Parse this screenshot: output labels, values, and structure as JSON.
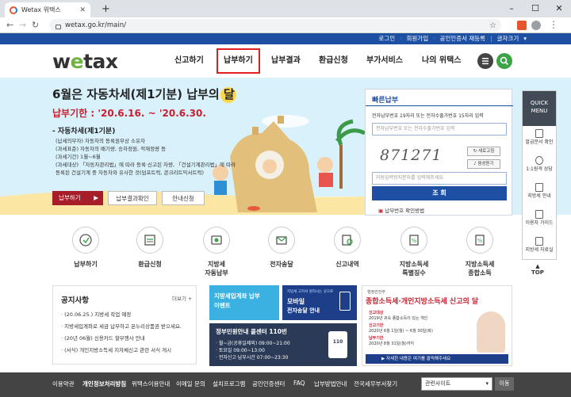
{
  "browser": {
    "tab_title": "Wetax 위택스",
    "url": "wetax.go.kr/main/"
  },
  "util_links": [
    "로그인",
    "회원가입",
    "공인인증서 재등록",
    "글자크기"
  ],
  "header": {
    "logo_pre": "w",
    "logo_mid": "e",
    "logo_post": "tax",
    "menu": [
      "신고하기",
      "납부하기",
      "납부결과",
      "환급신청",
      "부가서비스",
      "나의 위택스"
    ]
  },
  "hero": {
    "title": "6월은 자동차세(제1기분) 납부의 달",
    "period_label": "납부기한",
    "period_value": " : '20.6.16. ~ '20.6.30.",
    "section_title": "- 자동차세(제1기분)",
    "lines": [
      "(납세의무자) 자동차의 등록원부상 소유자",
      "(과세표준) 자동차의 배기량, 승차정원, 적재정량 등",
      "(과세기간) 1월~6월",
      "(과세대상) 「자동차관리법」에 따라 등록·신고된 차량, 「건설기계관리법」에 따라",
      "등록된 건설기계 중 자동차와 유사한 것(덤프트럭, 콘크리트믹서트럭)"
    ],
    "btn_pay": "납부하기",
    "btn_check": "납부결과확인",
    "btn_guide": "안내신청"
  },
  "quick_pay": {
    "title": "빠른납부",
    "desc": "전자납부번호 19자리 또는 전자수출가번호 15자리 입력",
    "input_placeholder": "전자납부번호 또는 전자수출가번호 입력",
    "captcha": "871271",
    "refresh": "새로고침",
    "audio": "음성듣기",
    "captcha_placeholder": "자동입력방지문자를 입력해주세요.",
    "submit": "조 회",
    "link": "납부번호 확인방법"
  },
  "quick_menu": {
    "head_1": "QUICK",
    "head_2": "MENU",
    "items": [
      "발급문서 확인",
      "1:1원격 상담",
      "지방세 안내",
      "이용자 가이드",
      "지방세 자료실"
    ],
    "top": "TOP"
  },
  "services": [
    {
      "l1": "납부하기",
      "l2": ""
    },
    {
      "l1": "환급신청",
      "l2": ""
    },
    {
      "l1": "지방세",
      "l2": "자동납부"
    },
    {
      "l1": "전자송달",
      "l2": ""
    },
    {
      "l1": "신고내역",
      "l2": ""
    },
    {
      "l1": "지방소득세",
      "l2": "특별징수"
    },
    {
      "l1": "지방소득세",
      "l2": "종합소득"
    }
  ],
  "notice": {
    "title": "공지사항",
    "more": "더보기 +",
    "items": [
      "· (20.06.25.) 지방세 작업 예정",
      "· 지방세입계좌로 세금 납부하고 온누리상품권 받으세요.",
      "· (20년 06월) 신용카드 할부행사 안내",
      "· (서식) 개인지방소득세 지자체신고 관련 서식 게시"
    ]
  },
  "banner1": {
    "title": "지방세입계좌 납부",
    "sub": "이벤트"
  },
  "banner2": {
    "title": "지방세 고지서 원하시는 곳으로",
    "big": "모바일",
    "sub": "전자송달 안내"
  },
  "banner3": {
    "title": "정부민원안내 콜센터 110번",
    "rows": [
      "· 월~금(공휴일제외)  09:00~21:00",
      "· 토요일  09:00~13:00",
      "· 전자신고·납부시간  07:00~23:30"
    ]
  },
  "banner4": {
    "tag": "행정안전부",
    "title": "종합소득세·개인지방소득세 신고의 달",
    "lines": [
      "신고대상",
      "2019년 귀속 종합소득이 있는 개인",
      "신고기한",
      "2020년 6월 1일(월) ~ 6월 30일(화)",
      "납부기한",
      "2020년 8월 31일(월)까지"
    ],
    "cta": "▶ 자세한 내용은 여기를 클릭해주세요"
  },
  "footer": {
    "links": [
      "이용약관",
      "개인정보처리방침",
      "위택스이용안내",
      "이메일 문의",
      "설치프로그램",
      "공인인증센터",
      "FAQ",
      "납부방법안내",
      "전국세무부서찾기"
    ],
    "select": "관련사이트",
    "go": "이동"
  },
  "colors": {
    "brand_blue": "#1d4fa3",
    "brand_green": "#6cb33f",
    "highlight_red": "#e31e1e"
  }
}
